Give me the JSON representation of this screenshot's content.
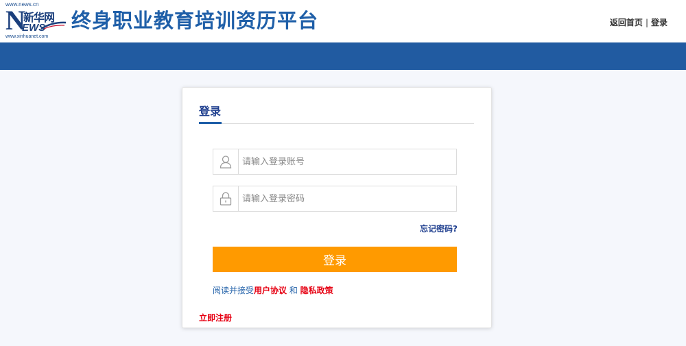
{
  "logo": {
    "top_text": "www.news.cn",
    "cn_text": "新华网",
    "news_text": "N",
    "ews_text": "EWS",
    "bottom_text": "www.xinhuanet.com"
  },
  "header": {
    "site_title": "终身职业教育培训资历平台",
    "nav": {
      "home": "返回首页",
      "separator": "|",
      "login": "登录"
    }
  },
  "colors": {
    "brand_blue": "#215ba1",
    "title_blue": "#1f5fa8",
    "accent_orange": "#ff9a00",
    "link_red": "#e60012"
  },
  "login_form": {
    "title": "登录",
    "account_field": {
      "icon": "user-icon",
      "value": "",
      "placeholder": "请输入登录账号"
    },
    "password_field": {
      "icon": "lock-icon",
      "value": "",
      "placeholder": "请输入登录密码"
    },
    "forgot_password": "忘记密码?",
    "submit_label": "登录",
    "agreement": {
      "prefix": "阅读并接受",
      "user_agreement": "用户协议",
      "and": " 和 ",
      "privacy_policy": "隐私政策"
    },
    "register_link": "立即注册"
  }
}
